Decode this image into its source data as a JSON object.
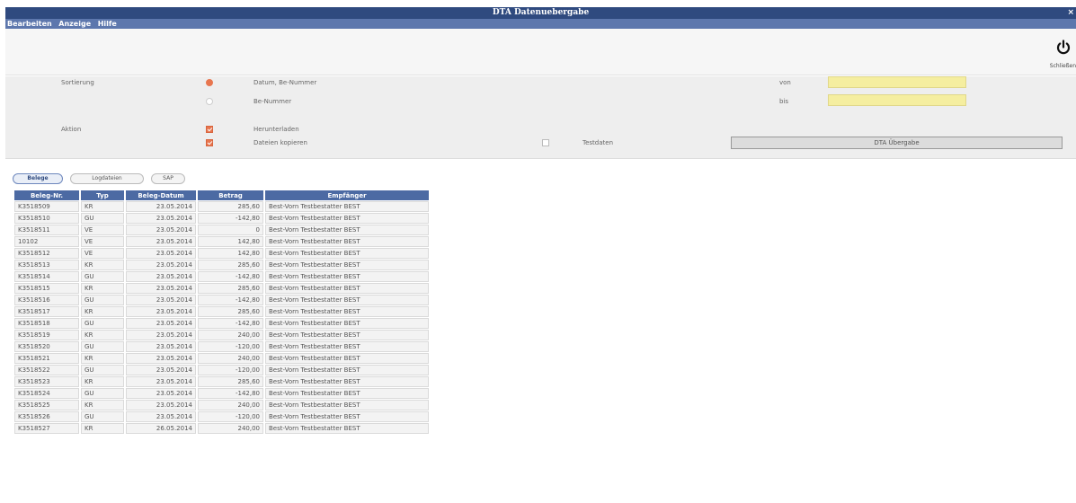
{
  "window": {
    "title": "DTA Datenuebergabe",
    "close_glyph": "×"
  },
  "menu": [
    "Bearbeiten",
    "Anzeige",
    "Hilfe"
  ],
  "toolbar": {
    "close_label": "Schließen",
    "close_icon": "power-icon"
  },
  "form": {
    "sort_label": "Sortierung",
    "sort_options": [
      {
        "label": "Datum, Be-Nummer",
        "selected": true
      },
      {
        "label": "Be-Nummer",
        "selected": false
      }
    ],
    "von_label": "von",
    "bis_label": "bis",
    "von_value": "",
    "bis_value": "",
    "action_label": "Aktion",
    "actions": [
      {
        "label": "Herunterladen",
        "checked": true
      },
      {
        "label": "Dateien kopieren",
        "checked": true
      }
    ],
    "testdaten_label": "Testdaten",
    "testdaten_checked": false,
    "dta_button": "DTA Übergabe"
  },
  "tabs": [
    {
      "label": "Belege",
      "active": true
    },
    {
      "label": "Logdateien",
      "active": false
    },
    {
      "label": "SAP",
      "active": false
    }
  ],
  "table": {
    "columns": [
      "Beleg-Nr.",
      "Typ",
      "Beleg-Datum",
      "Betrag",
      "Empfänger"
    ],
    "rows": [
      [
        "K3518509",
        "KR",
        "23.05.2014",
        "285,60",
        "Best-Vorn Testbestatter BEST"
      ],
      [
        "K3518510",
        "GU",
        "23.05.2014",
        "-142,80",
        "Best-Vorn Testbestatter BEST"
      ],
      [
        "K3518511",
        "VE",
        "23.05.2014",
        "0",
        "Best-Vorn Testbestatter BEST"
      ],
      [
        "10102",
        "VE",
        "23.05.2014",
        "142,80",
        "Best-Vorn Testbestatter BEST"
      ],
      [
        "K3518512",
        "VE",
        "23.05.2014",
        "142,80",
        "Best-Vorn Testbestatter BEST"
      ],
      [
        "K3518513",
        "KR",
        "23.05.2014",
        "285,60",
        "Best-Vorn Testbestatter BEST"
      ],
      [
        "K3518514",
        "GU",
        "23.05.2014",
        "-142,80",
        "Best-Vorn Testbestatter BEST"
      ],
      [
        "K3518515",
        "KR",
        "23.05.2014",
        "285,60",
        "Best-Vorn Testbestatter BEST"
      ],
      [
        "K3518516",
        "GU",
        "23.05.2014",
        "-142,80",
        "Best-Vorn Testbestatter BEST"
      ],
      [
        "K3518517",
        "KR",
        "23.05.2014",
        "285,60",
        "Best-Vorn Testbestatter BEST"
      ],
      [
        "K3518518",
        "GU",
        "23.05.2014",
        "-142,80",
        "Best-Vorn Testbestatter BEST"
      ],
      [
        "K3518519",
        "KR",
        "23.05.2014",
        "240,00",
        "Best-Vorn Testbestatter BEST"
      ],
      [
        "K3518520",
        "GU",
        "23.05.2014",
        "-120,00",
        "Best-Vorn Testbestatter BEST"
      ],
      [
        "K3518521",
        "KR",
        "23.05.2014",
        "240,00",
        "Best-Vorn Testbestatter BEST"
      ],
      [
        "K3518522",
        "GU",
        "23.05.2014",
        "-120,00",
        "Best-Vorn Testbestatter BEST"
      ],
      [
        "K3518523",
        "KR",
        "23.05.2014",
        "285,60",
        "Best-Vorn Testbestatter BEST"
      ],
      [
        "K3518524",
        "GU",
        "23.05.2014",
        "-142,80",
        "Best-Vorn Testbestatter BEST"
      ],
      [
        "K3518525",
        "KR",
        "23.05.2014",
        "240,00",
        "Best-Vorn Testbestatter BEST"
      ],
      [
        "K3518526",
        "GU",
        "23.05.2014",
        "-120,00",
        "Best-Vorn Testbestatter BEST"
      ],
      [
        "K3518527",
        "KR",
        "26.05.2014",
        "240,00",
        "Best-Vorn Testbestatter BEST"
      ]
    ]
  }
}
